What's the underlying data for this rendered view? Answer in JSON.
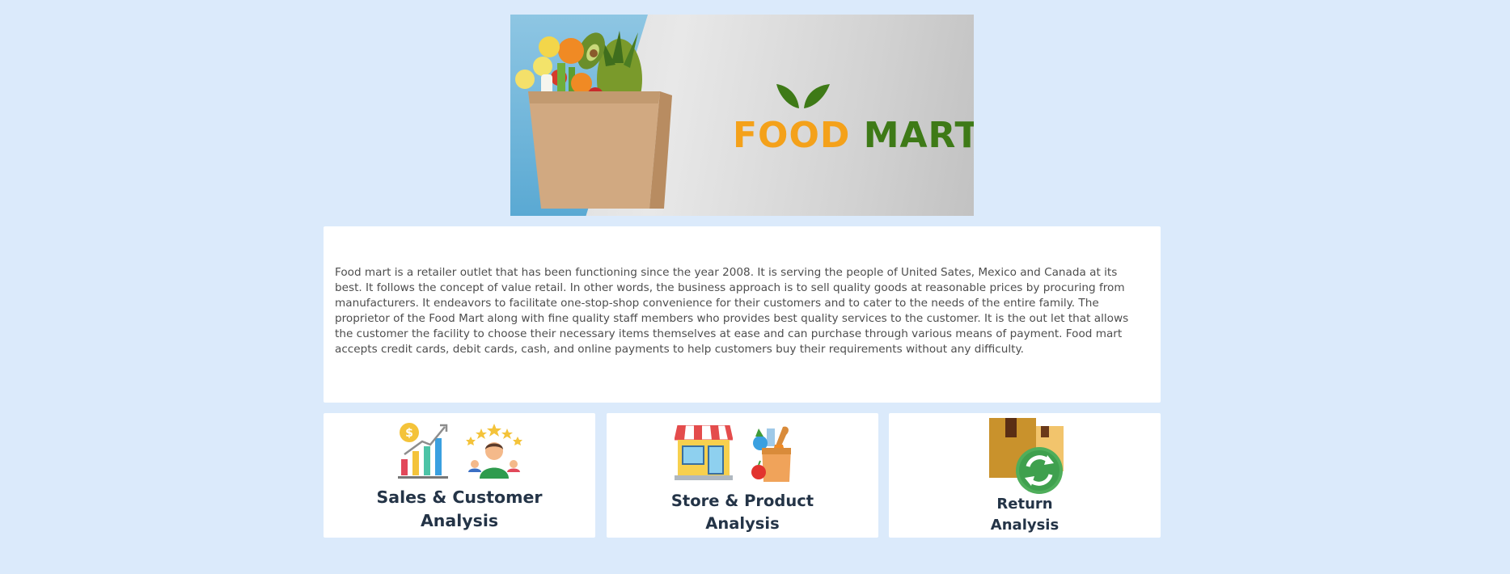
{
  "banner": {
    "logo_food": "FOOD",
    "logo_mart": "MART",
    "colors": {
      "food": "#f4a11a",
      "mart": "#3e7a17"
    }
  },
  "about": {
    "text": "Food mart is a retailer outlet that has been functioning since the year 2008. It is serving the people of United Sates, Mexico and Canada at its best. It follows the concept of value retail. In other words, the business approach is to sell quality goods at reasonable prices by procuring from manufacturers. It endeavors to facilitate one-stop-shop convenience for their customers and to cater to the needs of the entire family. The proprietor of the Food Mart along with fine quality staff members who provides best quality services to the customer. It is the out let that allows the customer the facility to choose their necessary items themselves at ease and can purchase through various means of payment. Food mart accepts credit cards, debit cards, cash, and online payments to help customers buy their requirements without any difficulty."
  },
  "cards": [
    {
      "line1": "Sales & Customer",
      "line2": "Analysis",
      "icons": [
        "sales-chart-icon",
        "customer-rating-icon"
      ]
    },
    {
      "line1": "Store & Product",
      "line2": "Analysis",
      "icons": [
        "store-icon",
        "grocery-bag-icon"
      ]
    },
    {
      "line1": "Return",
      "line2": "Analysis",
      "icons": [
        "return-box-icon"
      ]
    }
  ]
}
